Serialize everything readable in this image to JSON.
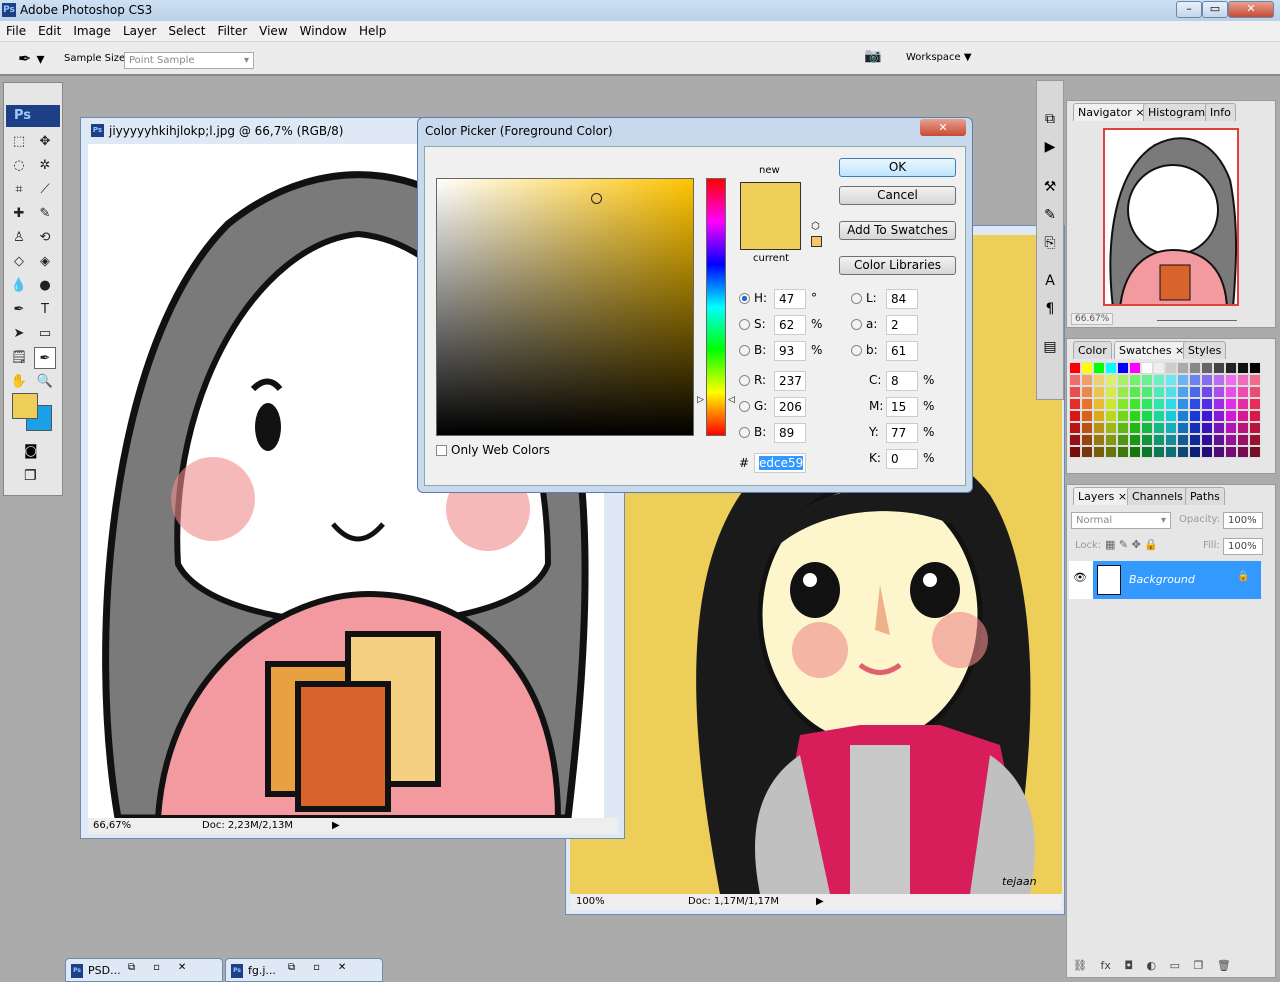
{
  "app": {
    "title": "Adobe Photoshop CS3",
    "logo": "Ps"
  },
  "menu": [
    "File",
    "Edit",
    "Image",
    "Layer",
    "Select",
    "Filter",
    "View",
    "Window",
    "Help"
  ],
  "options": {
    "sample_size_label": "Sample Size:",
    "sample_size_value": "Point Sample",
    "workspace_label": "Workspace ▼"
  },
  "doc1": {
    "title": "jiyyyyyhkihjlokp;l.jpg @ 66,7% (RGB/8)",
    "zoom": "66,67%",
    "doc_size": "Doc: 2,23M/2,13M"
  },
  "doc2": {
    "zoom": "100%",
    "doc_size": "Doc: 1,17M/1,17M",
    "signature": "tejaan"
  },
  "picker": {
    "title": "Color Picker (Foreground Color)",
    "new_label": "new",
    "current_label": "current",
    "ok": "OK",
    "cancel": "Cancel",
    "add_swatches": "Add To Swatches",
    "color_libraries": "Color Libraries",
    "only_web": "Only Web Colors",
    "hsb": [
      {
        "k": "H:",
        "v": "47",
        "u": "°",
        "on": true
      },
      {
        "k": "S:",
        "v": "62",
        "u": "%"
      },
      {
        "k": "B:",
        "v": "93",
        "u": "%"
      }
    ],
    "rgb": [
      {
        "k": "R:",
        "v": "237"
      },
      {
        "k": "G:",
        "v": "206"
      },
      {
        "k": "B:",
        "v": "89"
      }
    ],
    "lab": [
      {
        "k": "L:",
        "v": "84"
      },
      {
        "k": "a:",
        "v": "2"
      },
      {
        "k": "b:",
        "v": "61"
      }
    ],
    "cmyk": [
      {
        "k": "C:",
        "v": "8",
        "u": "%"
      },
      {
        "k": "M:",
        "v": "15",
        "u": "%"
      },
      {
        "k": "Y:",
        "v": "77",
        "u": "%"
      },
      {
        "k": "K:",
        "v": "0",
        "u": "%"
      }
    ],
    "hex_label": "#",
    "hex": "edce59",
    "new_color": "#edce59",
    "current_color": "#edce59",
    "hue_color": "#ffc400"
  },
  "foreground_color": "#edce59",
  "background_color": "#1aa0e6",
  "navigator": {
    "tabs": [
      "Navigator",
      "Histogram",
      "Info"
    ],
    "zoom": "66.67%"
  },
  "color_panel": {
    "tabs": [
      "Color",
      "Swatches",
      "Styles"
    ]
  },
  "layers": {
    "tabs": [
      "Layers",
      "Channels",
      "Paths"
    ],
    "blend": "Normal",
    "opacity_label": "Opacity:",
    "opacity": "100%",
    "lock_label": "Lock:",
    "fill_label": "Fill:",
    "fill": "100%",
    "items": [
      {
        "name": "Background"
      }
    ]
  },
  "taskbar": [
    {
      "label": "PSD..."
    },
    {
      "label": "fg.j..."
    }
  ]
}
